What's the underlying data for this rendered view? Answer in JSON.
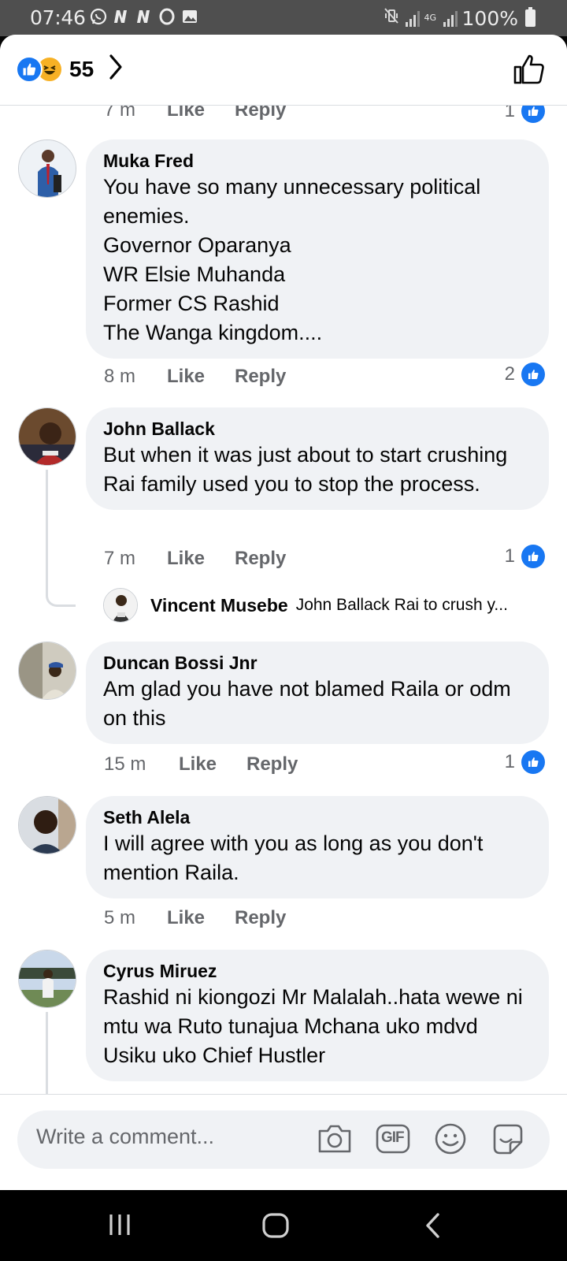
{
  "status_bar": {
    "time": "07:46",
    "battery": "100%",
    "network": "4G"
  },
  "header": {
    "reaction_count": "55",
    "reaction_icons": [
      "like-icon",
      "haha-icon"
    ],
    "accent_color": "#1877f2"
  },
  "partial_meta": {
    "time": "7 m",
    "like": "Like",
    "reply": "Reply",
    "count": "1"
  },
  "comments": [
    {
      "author": "Muka Fred",
      "text": "You have so many unnecessary political enemies.\nGovernor Oparanya\nWR Elsie Muhanda\nFormer CS Rashid\nThe Wanga kingdom....",
      "time": "8 m",
      "like": "Like",
      "reply": "Reply",
      "count": "2"
    },
    {
      "author": "John Ballack",
      "text": "But when it was just about to start crushing Rai family used you to stop the process.",
      "time": "7 m",
      "like": "Like",
      "reply": "Reply",
      "count": "1",
      "reply_preview": {
        "author": "Vincent Musebe",
        "text": "John Ballack Rai to crush y..."
      }
    },
    {
      "author": "Duncan Bossi Jnr",
      "text": "Am glad you have not blamed Raila or odm on this",
      "time": "15 m",
      "like": "Like",
      "reply": "Reply",
      "count": "1"
    },
    {
      "author": "Seth Alela",
      "text": "I will agree with you as long as you don't mention Raila.",
      "time": "5 m",
      "like": "Like",
      "reply": "Reply"
    },
    {
      "author": "Cyrus Miruez",
      "text": "Rashid ni kiongozi Mr Malalah..hata wewe ni mtu wa Ruto tunajua Mchana uko mdvd Usiku uko Chief Hustler"
    }
  ],
  "composer": {
    "placeholder": "Write a comment...",
    "gif_label": "GIF",
    "icons": [
      "camera-icon",
      "gif-icon",
      "emoji-icon",
      "sticker-icon"
    ]
  },
  "navbar": {
    "icons": [
      "recent-apps-icon",
      "home-icon",
      "back-icon"
    ]
  }
}
